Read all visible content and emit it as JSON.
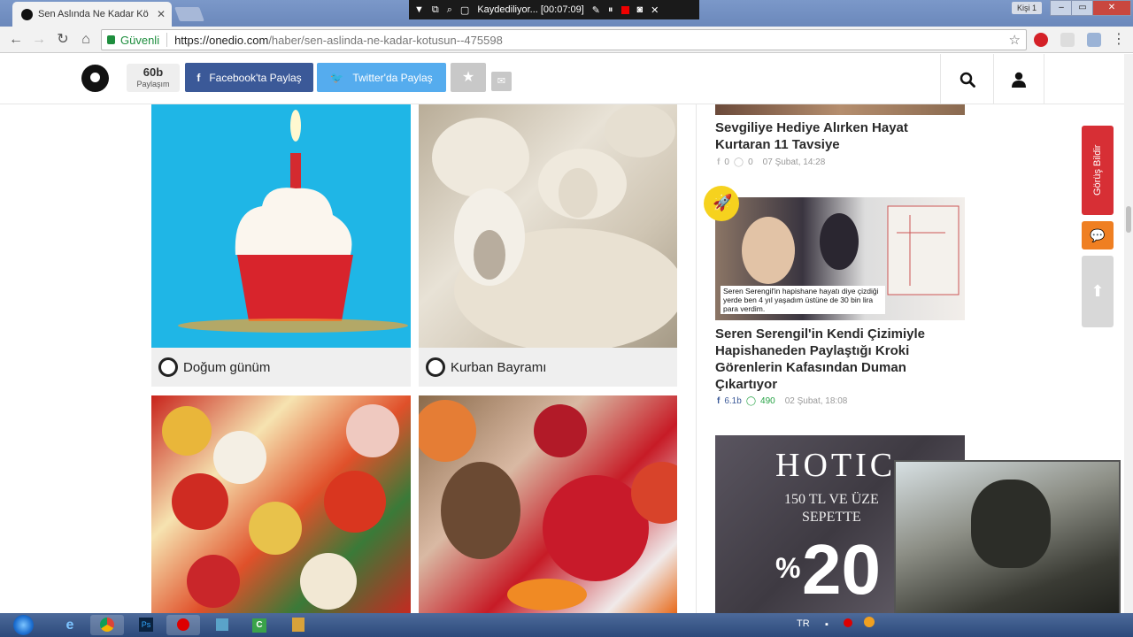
{
  "browser": {
    "tab_title": "Sen Aslında Ne Kadar Kö",
    "tab_close": "✕",
    "recorder_status": "Kaydediliyor... [00:07:09]",
    "profile_label": "Kişi 1",
    "secure_label": "Güvenli",
    "url_host": "https://onedio.com",
    "url_path": "/haber/sen-aslinda-ne-kadar-kotusun--475598"
  },
  "header": {
    "share_count": "60b",
    "share_count_label": "Paylaşım",
    "facebook_share": "Facebook'ta Paylaş",
    "twitter_share": "Twitter'da Paylaş"
  },
  "options": [
    {
      "label": "Doğum günüm"
    },
    {
      "label": "Kurban Bayramı"
    }
  ],
  "sidebar": {
    "items": [
      {
        "title": "Sevgiliye Hediye Alırken Hayat Kurtaran 11 Tavsiye",
        "fb_count": "0",
        "wa_count": "0",
        "date": "07 Şubat, 14:28"
      },
      {
        "title": "Seren Serengil'in Kendi Çizimiyle Hapishaneden Paylaştığı Kroki Görenlerin Kafasından Duman Çıkartıyor",
        "image_caption": "Seren Serengil'in hapishane hayatı diye çizdiği yerde ben 4 yıl yaşadım üstüne de 30 bin lira para verdim.",
        "fb_count": "6.1b",
        "wa_count": "490",
        "date": "02 Şubat, 18:08"
      }
    ],
    "ad": {
      "brand": "HOTIC",
      "line": "150 TL VE ÜZE",
      "line2": "SEPETTE",
      "percent": "%",
      "number": "20"
    }
  },
  "feedback_label": "Görüş Bildir",
  "taskbar": {
    "language": "TR"
  },
  "colors": {
    "facebook": "#3b5998",
    "twitter": "#55acee",
    "feedback": "#d72f35",
    "chat": "#ef7f22",
    "secure": "#1e8e3e"
  }
}
